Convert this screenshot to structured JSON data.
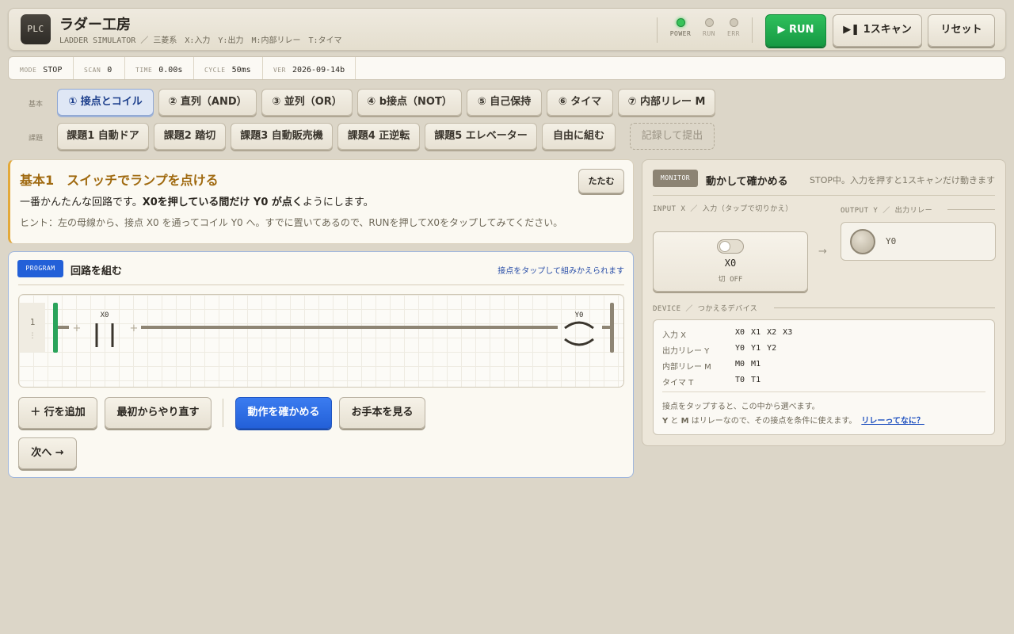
{
  "app": {
    "logo": "PLC",
    "title": "ラダー工房",
    "subtitle": "LADDER SIMULATOR ／ 三菱系　X:入力　Y:出力　M:内部リレー　T:タイマ"
  },
  "indicators": [
    {
      "label": "POWER",
      "on": true
    },
    {
      "label": "RUN",
      "on": false
    },
    {
      "label": "ERR",
      "on": false
    }
  ],
  "controls": {
    "run": "▶ RUN",
    "step": "▶❚ 1スキャン",
    "reset": "リセット"
  },
  "status": {
    "mode_key": "MODE",
    "mode": "STOP",
    "scan_key": "SCAN",
    "scan": "0",
    "time_key": "TIME",
    "time": "0.00s",
    "cycle_key": "CYCLE",
    "cycle": "50ms",
    "ver_key": "VER",
    "ver": "2026-09-14b"
  },
  "basics": {
    "label": "基本",
    "tabs": [
      "① 接点とコイル",
      "② 直列（AND）",
      "③ 並列（OR）",
      "④ b接点（NOT）",
      "⑤ 自己保持",
      "⑥ タイマ",
      "⑦ 内部リレー M"
    ],
    "active_index": 0
  },
  "tasks": {
    "label": "課題",
    "tabs": [
      "課題1 自動ドア",
      "課題2 踏切",
      "課題3 自動販売機",
      "課題4 正逆転",
      "課題5 エレベーター",
      "自由に組む"
    ],
    "submit": "記録して提出"
  },
  "lesson": {
    "title": "基本1　スイッチでランプを点ける",
    "desc_pre": "一番かんたんな回路です。",
    "desc_bold": "X0を押している間だけ Y0 が点く",
    "desc_post": "ようにします。",
    "hint": "ヒント：左の母線から、接点 X0 を通ってコイル Y0 へ。すでに置いてあるので、RUNを押してX0をタップしてみてください。",
    "fold": "たたむ"
  },
  "program": {
    "badge": "PROGRAM",
    "title": "回路を組む",
    "note": "接点をタップして組みかえられます",
    "rung_number": "1",
    "rung_dots": "⋮",
    "plus": "+",
    "contact_label": "X0",
    "coil_label": "Y0",
    "buttons": {
      "add_row": "＋ 行を追加",
      "restart": "最初からやり直す",
      "check": "動作を確かめる",
      "example": "お手本を見る",
      "next": "次へ →"
    }
  },
  "monitor": {
    "badge": "MONITOR",
    "title": "動かして確かめる",
    "note": "STOP中。入力を押すと1スキャンだけ動きます",
    "input_label": "INPUT X ／ 入力（タップで切りかえ）",
    "output_label": "OUTPUT Y ／ 出力リレー",
    "arrow": "→",
    "input": {
      "name": "X0",
      "state": "切 OFF"
    },
    "output": {
      "name": "Y0"
    },
    "device_label": "DEVICE ／ つかえるデバイス",
    "devices": [
      {
        "label": "入力 X",
        "items": "X0 X1 X2 X3"
      },
      {
        "label": "出力リレー Y",
        "items": "Y0 Y1 Y2"
      },
      {
        "label": "内部リレー M",
        "items": "M0 M1"
      },
      {
        "label": "タイマ T",
        "items": "T0 T1"
      }
    ],
    "device_note1": "接点をタップすると、この中から選べます。",
    "device_note2_pre": "Y",
    "device_note2_mid": " と ",
    "device_note2_m": "M",
    "device_note2_post": " はリレーなので、その接点を条件に使えます。",
    "device_link": "リレーってなに？"
  },
  "colors": {
    "accent_blue": "#2360d8",
    "run_green": "#169a43",
    "lesson_accent": "#e3a93a",
    "bus_green": "#2aa35a"
  }
}
